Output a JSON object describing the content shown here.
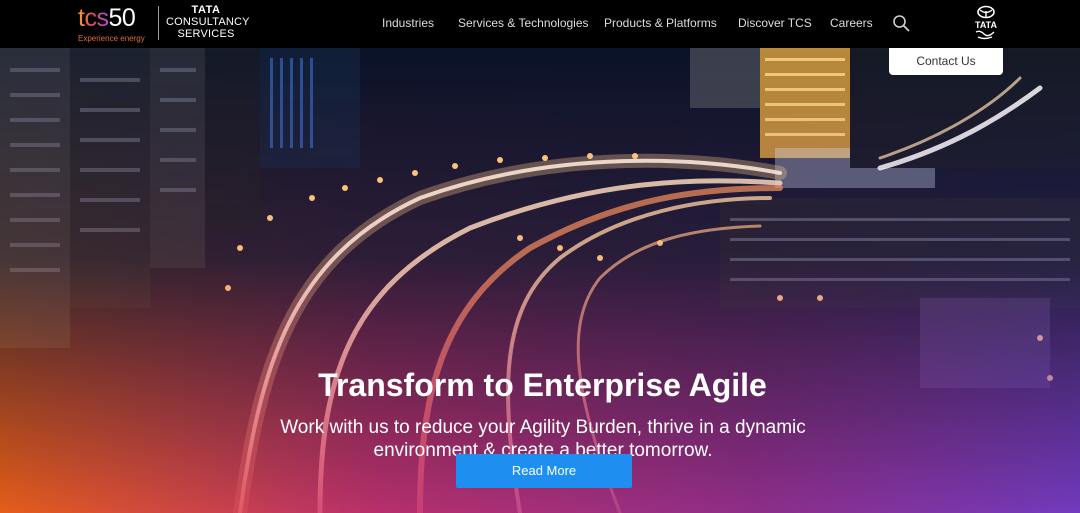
{
  "brand": {
    "tcs50_prefix": "tcs",
    "tcs50_number": "50",
    "tagline": "Experience energy",
    "company_line1": "TATA",
    "company_line2": "CONSULTANCY",
    "company_line3": "SERVICES"
  },
  "nav": {
    "items": [
      "Industries",
      "Services & Technologies",
      "Products & Platforms",
      "Discover TCS",
      "Careers"
    ],
    "search_icon": "search-icon",
    "corner_logo_text": "TATA"
  },
  "contact_label": "Contact Us",
  "hero": {
    "title": "Transform to Enterprise Agile",
    "subtitle": "Work with us to reduce your Agility Burden, thrive in a dynamic environment & create a better tomorrow.",
    "cta_label": "Read More"
  },
  "colors": {
    "header_bg": "#000000",
    "cta_bg": "#1e8ff0",
    "gradient_orange": "#f05a1a",
    "gradient_magenta": "#b8308a",
    "gradient_purple": "#7a3fd0"
  }
}
